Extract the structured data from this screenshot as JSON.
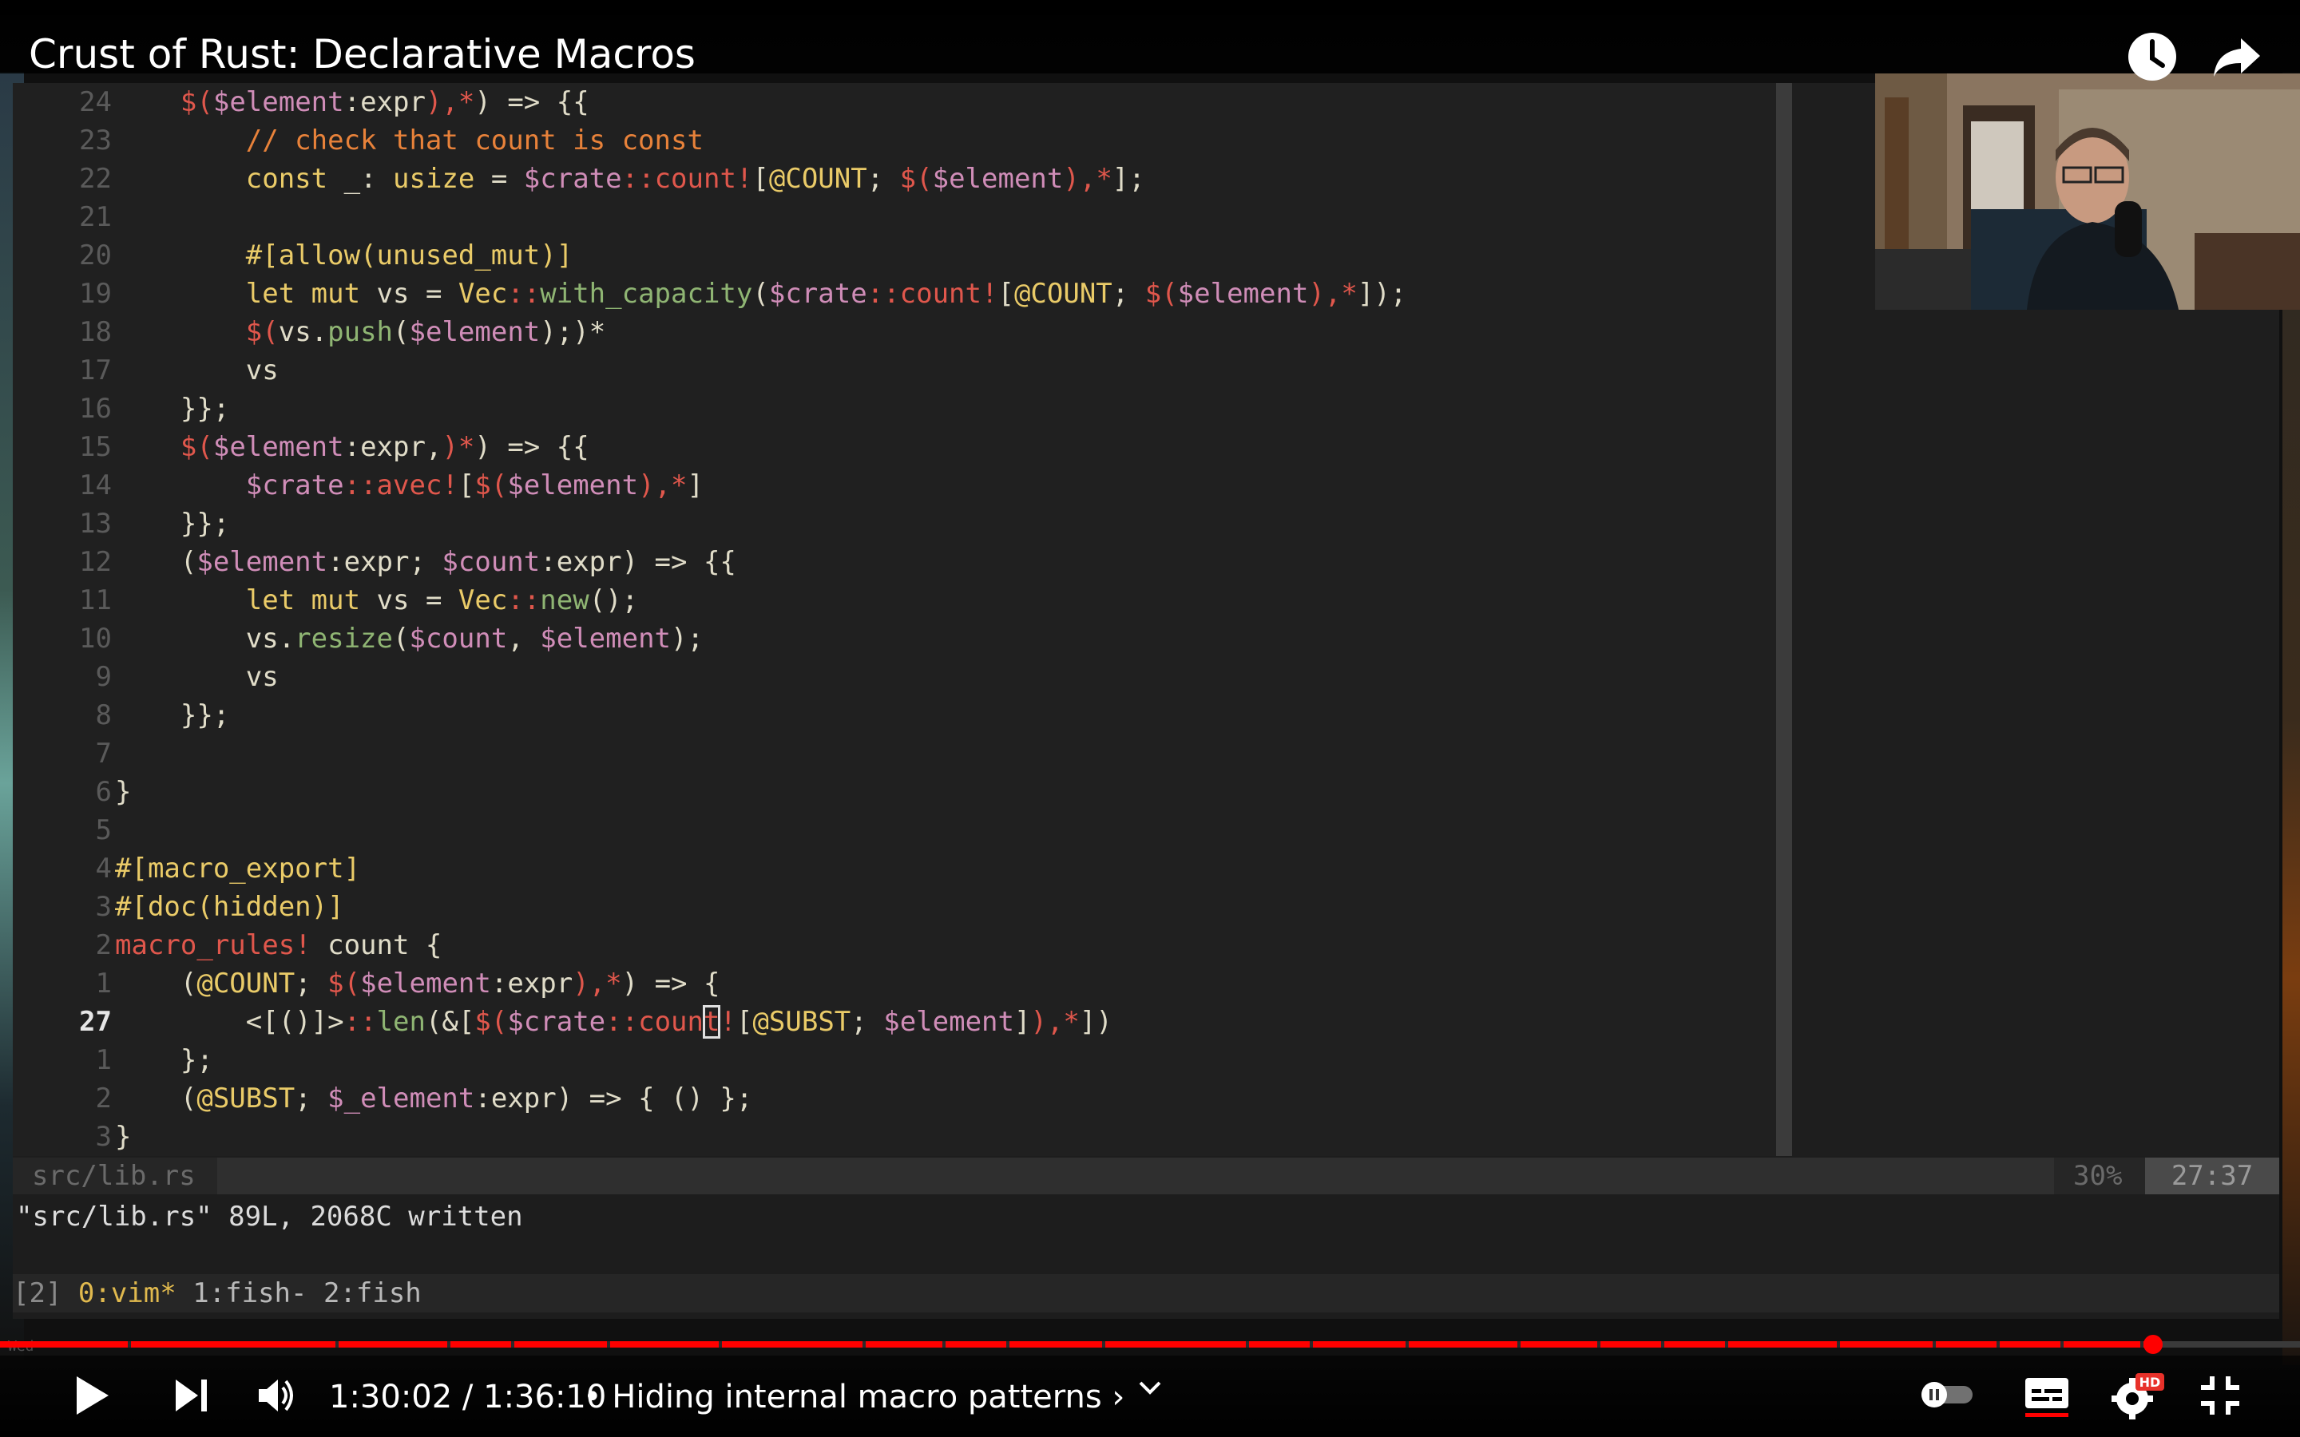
{
  "player": {
    "title": "Crust of Rust: Declarative Macros",
    "time_current": "1:30:02",
    "time_separator": "/",
    "time_total": "1:36:10",
    "chapter": "• Hiding internal macro patterns ›",
    "progress": 0.936,
    "icons": {
      "watch_later": "clock-icon",
      "share": "share-arrow-icon",
      "play": "play-icon",
      "next": "skip-next-icon",
      "volume": "volume-icon",
      "chapter_expand": "chevron-down-icon",
      "autoplay": "autoplay-toggle-icon",
      "captions": "captions-icon",
      "settings": "settings-gear-icon",
      "settings_badge": "HD",
      "fullscreen_exit": "exit-fullscreen-icon"
    },
    "colors": {
      "accent": "#ff0000"
    }
  },
  "editor": {
    "lines": [
      {
        "num": "24",
        "html": "    <span class=\"r\">$(</span><span class=\"p\">$element</span>:expr<span class=\"r\">),*</span>) => {{"
      },
      {
        "num": "23",
        "html": "        <span class=\"o\">// check that count is const</span>"
      },
      {
        "num": "22",
        "html": "        <span class=\"y\">const</span> _: <span class=\"y\">usize</span> = <span class=\"p\">$crate</span><span class=\"r\">::count!</span>[<span class=\"y\">@COUNT</span>; <span class=\"r\">$(</span><span class=\"p\">$element</span><span class=\"r\">),*</span>];"
      },
      {
        "num": "21",
        "html": ""
      },
      {
        "num": "20",
        "html": "        <span class=\"y\">#[allow(unused_mut)]</span>"
      },
      {
        "num": "19",
        "html": "        <span class=\"y\">let mut</span> vs = <span class=\"y\">Vec</span><span class=\"r\">::</span><span class=\"g\">with_capacity</span>(<span class=\"p\">$crate</span><span class=\"r\">::count!</span>[<span class=\"y\">@COUNT</span>; <span class=\"r\">$(</span><span class=\"p\">$element</span><span class=\"r\">),*</span>]);"
      },
      {
        "num": "18",
        "html": "        <span class=\"r\">$(</span>vs.<span class=\"g\">push</span>(<span class=\"p\">$element</span>);)*"
      },
      {
        "num": "17",
        "html": "        vs"
      },
      {
        "num": "16",
        "html": "    }};"
      },
      {
        "num": "15",
        "html": "    <span class=\"r\">$(</span><span class=\"p\">$element</span>:expr,<span class=\"r\">)*</span>) => {{"
      },
      {
        "num": "14",
        "html": "        <span class=\"p\">$crate</span><span class=\"r\">::avec!</span>[<span class=\"r\">$(</span><span class=\"p\">$element</span><span class=\"r\">),*</span>]"
      },
      {
        "num": "13",
        "html": "    }};"
      },
      {
        "num": "12",
        "html": "    (<span class=\"p\">$element</span>:expr; <span class=\"p\">$count</span>:expr) => {{"
      },
      {
        "num": "11",
        "html": "        <span class=\"y\">let mut</span> vs = <span class=\"y\">Vec</span><span class=\"r\">::</span><span class=\"g\">new</span>();"
      },
      {
        "num": "10",
        "html": "        vs.<span class=\"g\">resize</span>(<span class=\"p\">$count</span>, <span class=\"p\">$element</span>);"
      },
      {
        "num": "9",
        "html": "        vs"
      },
      {
        "num": "8",
        "html": "    }};"
      },
      {
        "num": "7",
        "html": ""
      },
      {
        "num": "6",
        "html": "}"
      },
      {
        "num": "5",
        "html": ""
      },
      {
        "num": "4",
        "html": "<span class=\"y\">#[macro_export]</span>"
      },
      {
        "num": "3",
        "html": "<span class=\"y\">#[doc(hidden)]</span>"
      },
      {
        "num": "2",
        "html": "<span class=\"r\">macro_rules!</span> count {"
      },
      {
        "num": "1",
        "html": "    (<span class=\"y\">@COUNT</span>; <span class=\"r\">$(</span><span class=\"p\">$element</span>:expr<span class=\"r\">),*</span>) => {"
      },
      {
        "num": "27",
        "current": true,
        "html": "        <[()]><span class=\"r\">::</span><span class=\"g\">len</span>(&[<span class=\"r\">$(</span><span class=\"p\">$crate</span><span class=\"r\">::coun<span class=\"cursor\">t</span>!</span>[<span class=\"y\">@SUBST</span>; <span class=\"p\">$element</span>]<span class=\"r\">),*</span>])"
      },
      {
        "num": "1",
        "html": "    };"
      },
      {
        "num": "2",
        "html": "    (<span class=\"y\">@SUBST</span>; <span class=\"p\">$_element</span>:expr) => { () };"
      },
      {
        "num": "3",
        "html": "}"
      }
    ],
    "status_file": "src/lib.rs",
    "status_percent": "30%",
    "status_position": "27:37",
    "command_line": "\"src/lib.rs\" 89L, 2068C written",
    "tmux": {
      "session": "[2] ",
      "active_window": "0:vim*",
      "other_windows": " 1:fish- 2:fish"
    }
  }
}
